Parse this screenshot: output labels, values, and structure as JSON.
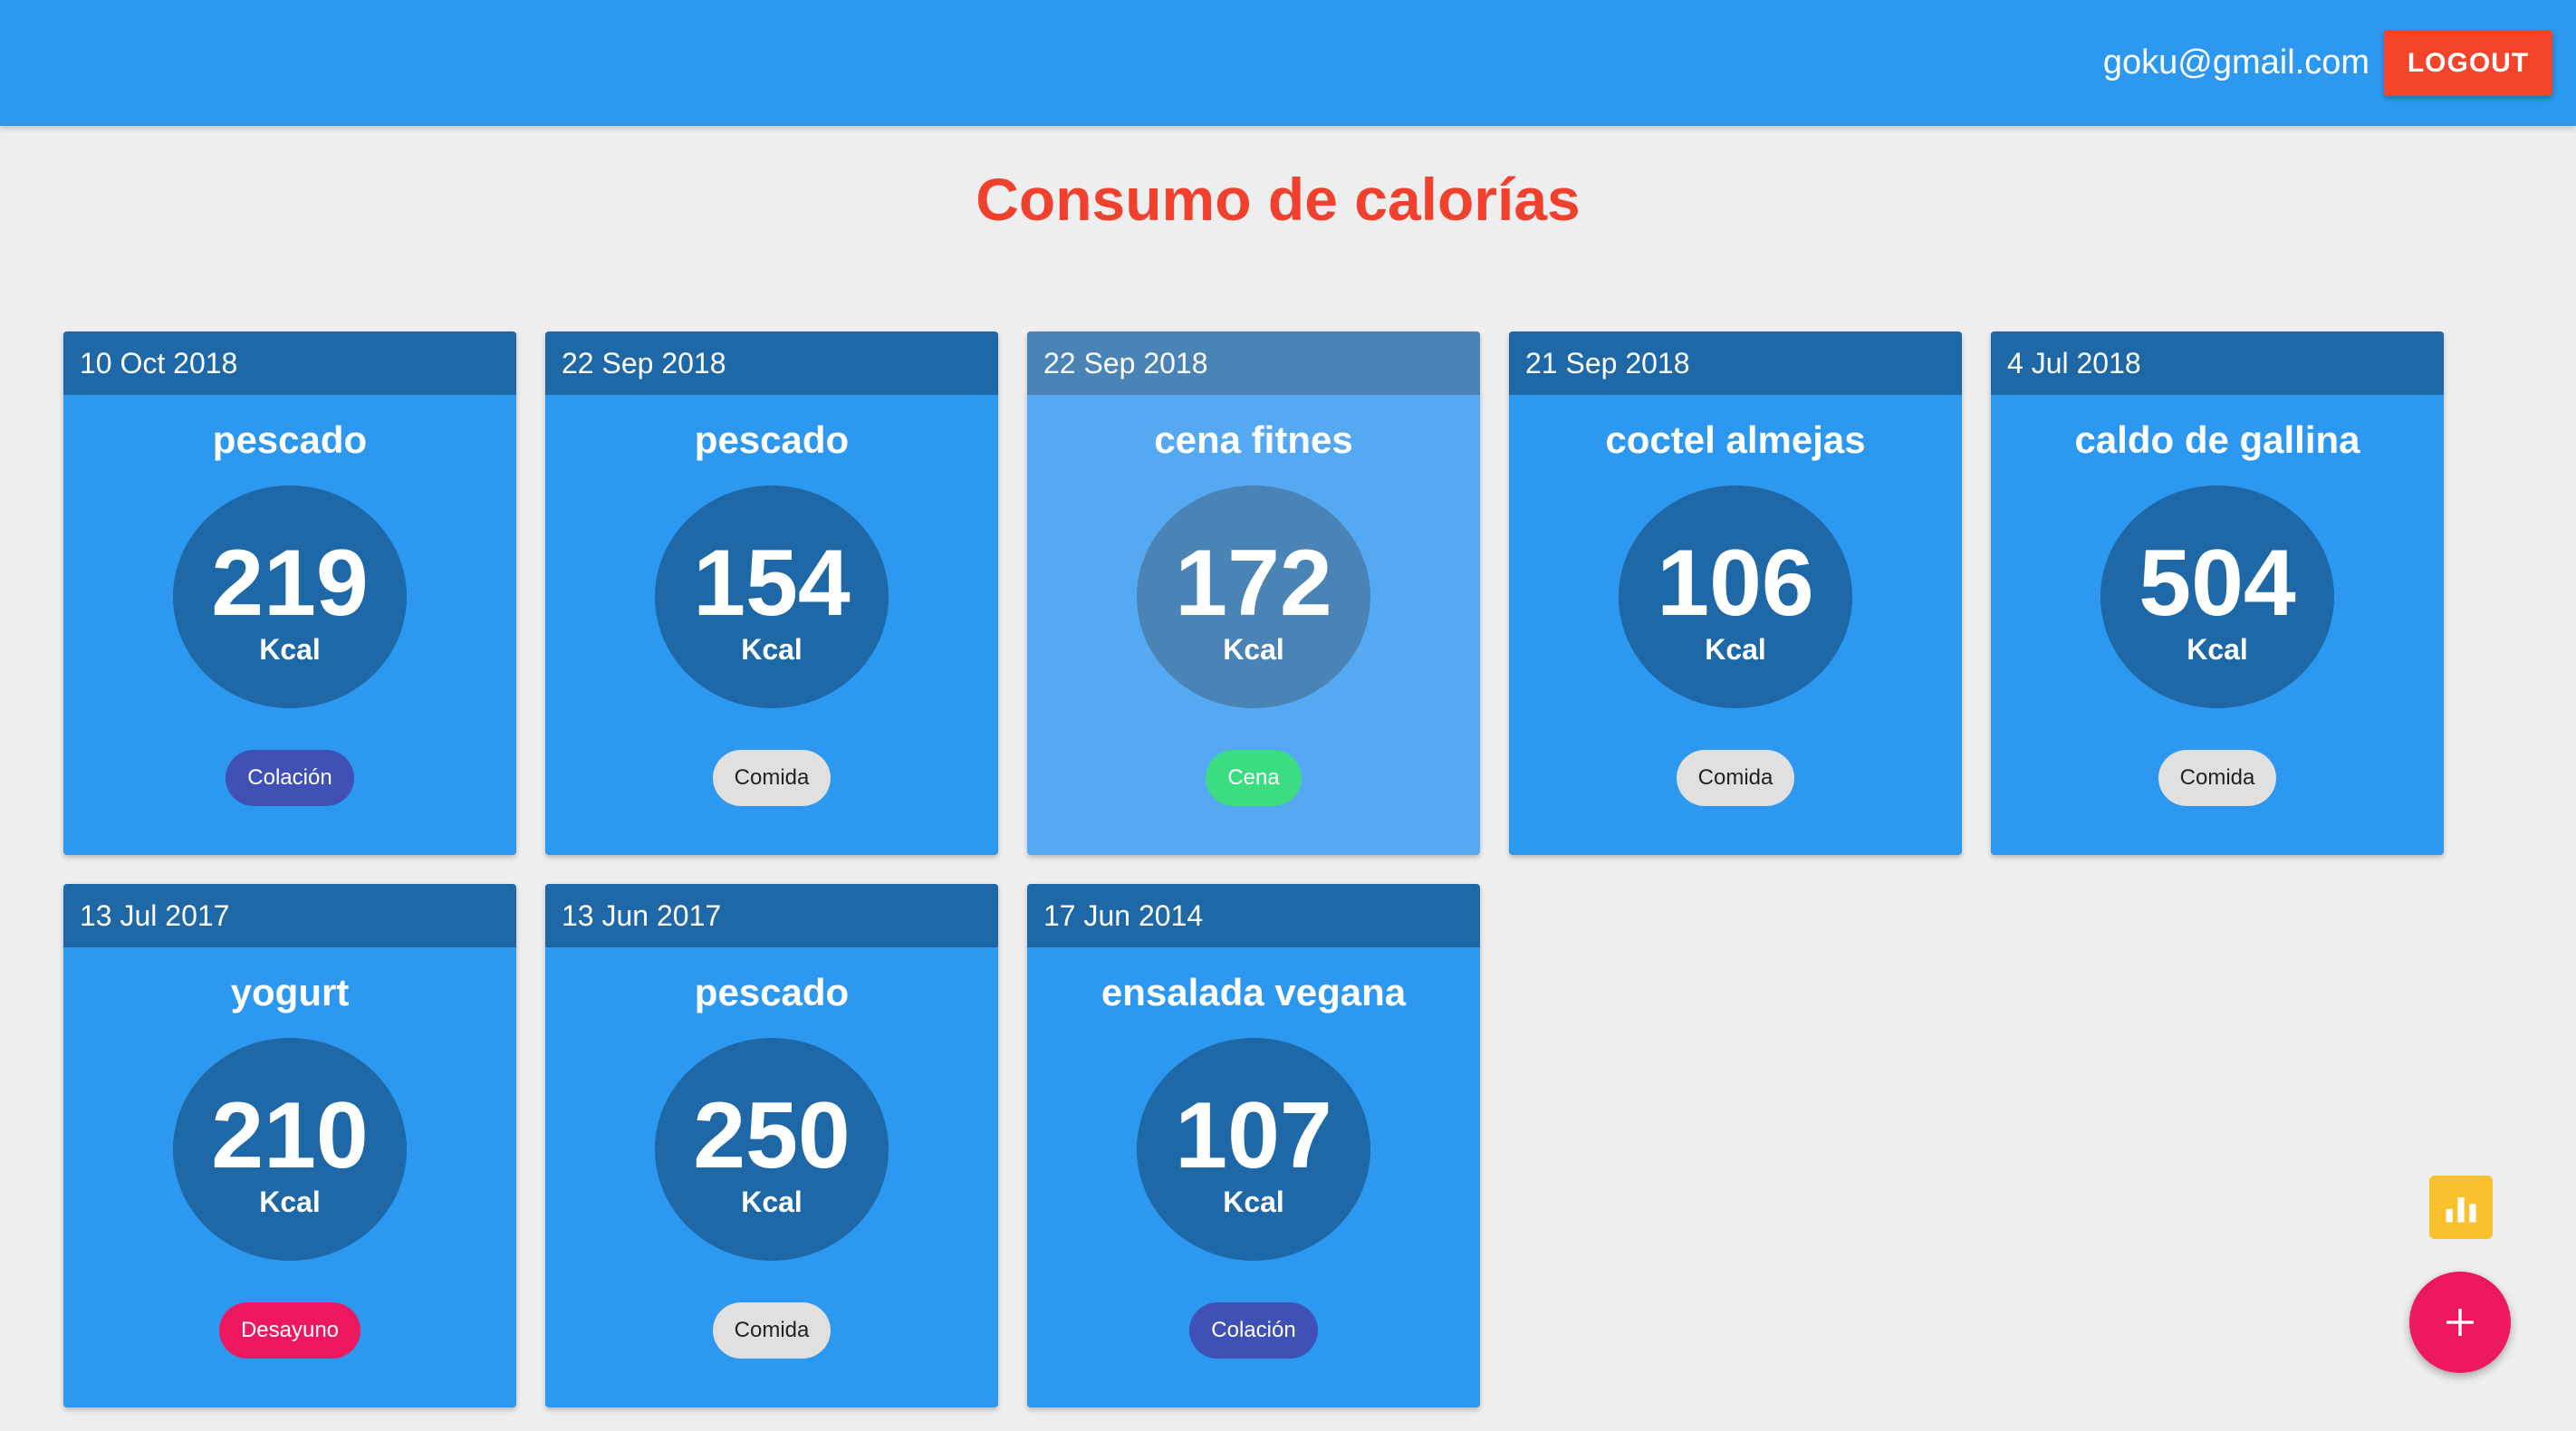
{
  "header": {
    "user_email": "goku@gmail.com",
    "logout_label": "LOGOUT"
  },
  "page": {
    "title": "Consumo de calorías"
  },
  "kcal_unit": "Kcal",
  "cards": [
    {
      "date": "10 Oct 2018",
      "name": "pescado",
      "kcal": "219",
      "tag": "Colación"
    },
    {
      "date": "22 Sep 2018",
      "name": "pescado",
      "kcal": "154",
      "tag": "Comida"
    },
    {
      "date": "22 Sep 2018",
      "name": "cena fitnes",
      "kcal": "172",
      "tag": "Cena"
    },
    {
      "date": "21 Sep 2018",
      "name": "coctel almejas",
      "kcal": "106",
      "tag": "Comida"
    },
    {
      "date": "4 Jul 2018",
      "name": "caldo de gallina",
      "kcal": "504",
      "tag": "Comida"
    },
    {
      "date": "13 Jul 2017",
      "name": "yogurt",
      "kcal": "210",
      "tag": "Desayuno"
    },
    {
      "date": "13 Jun 2017",
      "name": "pescado",
      "kcal": "250",
      "tag": "Comida"
    },
    {
      "date": "17 Jun 2014",
      "name": "ensalada vegana",
      "kcal": "107",
      "tag": "Colación"
    }
  ],
  "icons": {
    "stats": "bar-chart-icon",
    "add": "plus-icon"
  },
  "colors": {
    "appbar": "#2d98ef",
    "logout": "#f4452a",
    "title": "#f0412f",
    "card": "#2d98ef",
    "card_header": "#1f68a7",
    "tag_colacion": "#3f51b5",
    "tag_comida": "#e0e0e0",
    "tag_cena": "#3cdc82",
    "tag_desayuno": "#ee1861",
    "stats_button": "#fbc02d",
    "add_button": "#ee1861"
  }
}
